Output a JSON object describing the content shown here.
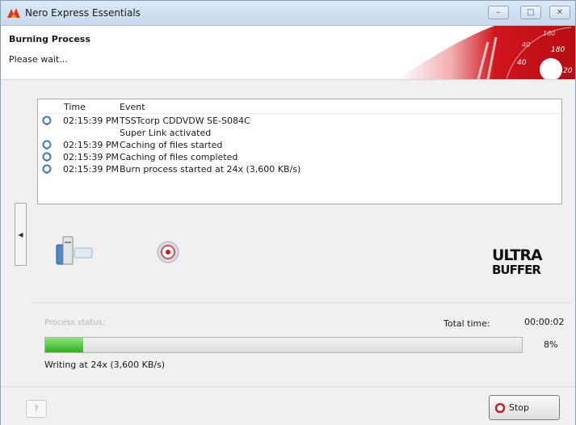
{
  "window": {
    "title": "Nero Express Essentials",
    "controls": {
      "minimize": "–",
      "maximize": "□",
      "close": "✕"
    }
  },
  "header": {
    "title": "Burning Process",
    "subtitle": "Please wait...",
    "banner_numbers": [
      "160",
      "180",
      "20",
      "40",
      "40"
    ]
  },
  "log": {
    "columns": {
      "time": "Time",
      "event": "Event"
    },
    "rows": [
      {
        "time": "02:15:39 PM",
        "event": "TSSTcorp CDDVDW SE-S084C",
        "icon": "info-icon"
      },
      {
        "time": "",
        "event": "Super Link activated",
        "icon": ""
      },
      {
        "time": "02:15:39 PM",
        "event": "Caching of files started",
        "icon": "info-icon"
      },
      {
        "time": "02:15:39 PM",
        "event": "Caching of files completed",
        "icon": "info-icon"
      },
      {
        "time": "02:15:39 PM",
        "event": "Burn process started at 24x (3,600 KB/s)",
        "icon": "info-icon"
      }
    ]
  },
  "branding": {
    "logo_line1": "ULTRA",
    "logo_line2": "BUFFER"
  },
  "status": {
    "process_status_label": "Process status:",
    "total_time_label": "Total time:",
    "total_time_value": "00:00:02",
    "progress_fraction": 0.08,
    "progress_percent": "8%",
    "speed_text": "Writing at 24x (3,600 KB/s)"
  },
  "footer": {
    "help_glyph": "?",
    "stop_label": "Stop"
  },
  "colors": {
    "accent_red": "#d0151c",
    "progress_green": "#3cb52c",
    "info_blue": "#3a78c9"
  }
}
